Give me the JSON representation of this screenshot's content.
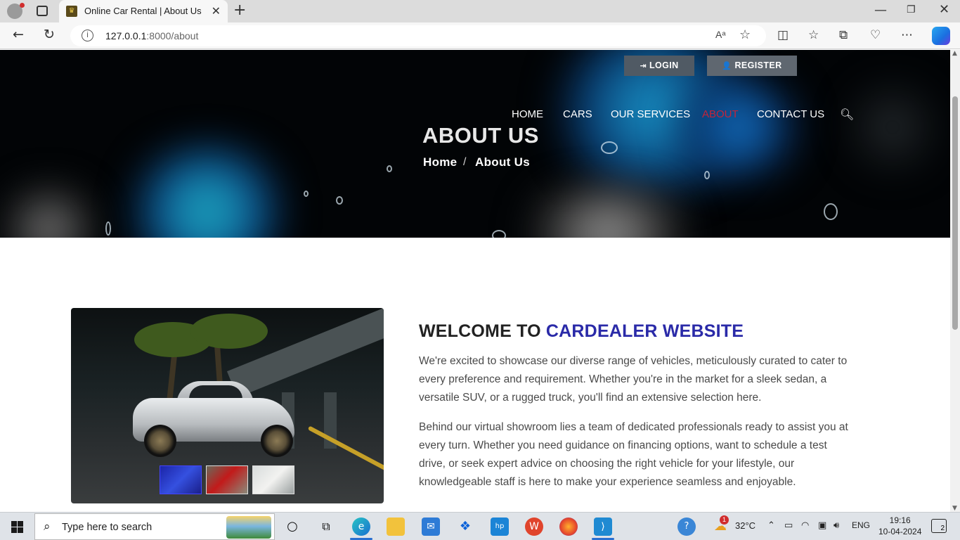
{
  "browser": {
    "tab_title": "Online Car Rental | About Us",
    "url_host": "127.0.0.1",
    "url_path": ":8000/about",
    "read_aloud": "Aᵃ"
  },
  "header": {
    "login_label": "LOGIN",
    "register_label": "REGISTER",
    "nav": [
      {
        "label": "HOME",
        "active": false
      },
      {
        "label": "CARS",
        "active": false
      },
      {
        "label": "OUR SERVICES",
        "active": false
      },
      {
        "label": "ABOUT",
        "active": true
      },
      {
        "label": "CONTACT US",
        "active": false
      }
    ],
    "active_color": "#c4243a"
  },
  "hero": {
    "title": "ABOUT US",
    "breadcrumb": [
      "Home",
      "About Us"
    ],
    "breadcrumb_sep": "/"
  },
  "about": {
    "heading_prefix": "WELCOME TO",
    "heading_highlight": "CARDEALER WEBSITE",
    "highlight_color": "#2a2aa8",
    "paragraph_1": "We're excited to showcase our diverse range of vehicles, meticulously curated to cater to every preference and requirement. Whether you're in the market for a sleek sedan, a versatile SUV, or a rugged truck, you'll find an extensive selection here.",
    "paragraph_2": "Behind our virtual showroom lies a team of dedicated professionals ready to assist you at every turn. Whether you need guidance on financing options, want to schedule a test drive, or seek expert advice on choosing the right vehicle for your lifestyle, our knowledgeable staff is here to make your experience seamless and enjoyable.",
    "thumbnails": [
      "blue-car-thumbnail",
      "red-car-thumbnail",
      "white-car-thumbnail"
    ]
  },
  "taskbar": {
    "search_placeholder": "Type here to search",
    "weather": "32°C",
    "weather_badge": "1",
    "language": "ENG",
    "time": "19:16",
    "date": "10-04-2024",
    "notifications": "2"
  }
}
